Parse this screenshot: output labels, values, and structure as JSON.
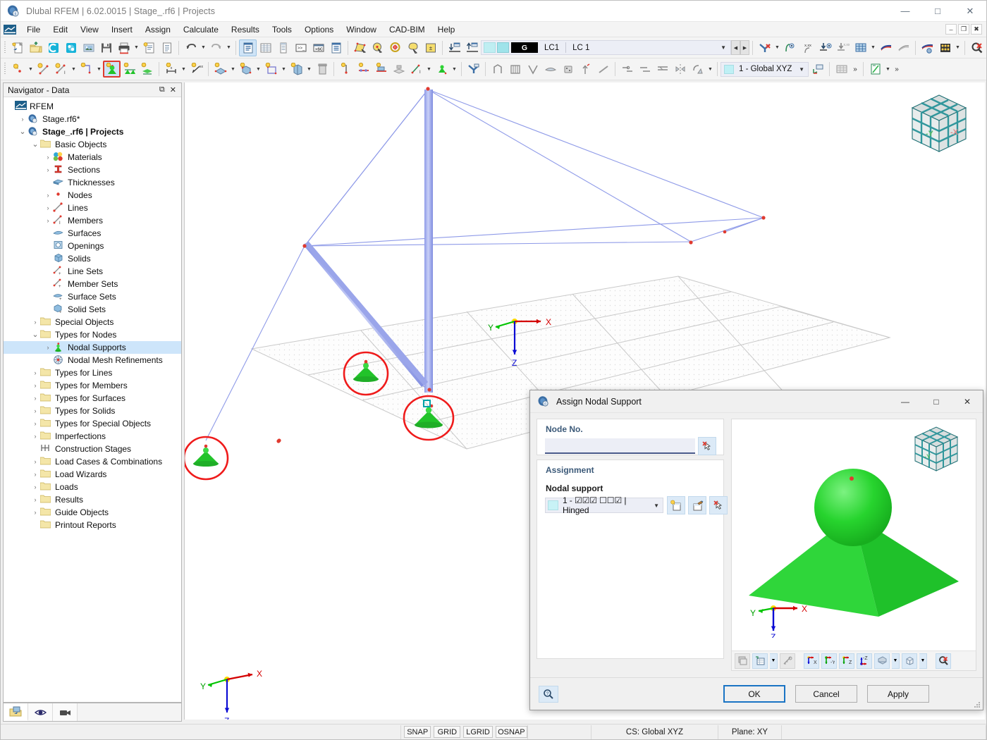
{
  "window": {
    "title": "Dlubal RFEM | 6.02.0015 | Stage_.rf6 | Projects",
    "minimize": "—",
    "maximize": "□",
    "close": "✕",
    "mdi_minimize": "–",
    "mdi_restore": "❐",
    "mdi_close": "✖"
  },
  "menu": {
    "items": [
      "File",
      "Edit",
      "View",
      "Insert",
      "Assign",
      "Calculate",
      "Results",
      "Tools",
      "Options",
      "Window",
      "CAD-BIM",
      "Help"
    ]
  },
  "toolbar_main": {
    "load_case": {
      "badge": "G",
      "code": "LC1",
      "name": "LC 1"
    },
    "icons": [
      "new-model-icon",
      "open-folder-icon",
      "cloud-connect-icon",
      "webservice-icon",
      "save-as-image-icon",
      "save-icon",
      "print-icon",
      "new-report-icon",
      "document-icon",
      "undo-icon",
      "redo-icon",
      "navigator-data-icon",
      "table-panel-icon",
      "table-single-icon",
      "console-icon",
      "script-icon",
      "report-icon",
      "select-area-icon",
      "select-objects-icon",
      "select-circle-icon",
      "select-lasso-icon",
      "select-by-value-icon",
      "lower-level-icon",
      "higher-level-icon",
      "visibility-icon",
      "render-icon",
      "result-value-icon",
      "support-display-icon",
      "grid-display-icon",
      "deformation-icon",
      "gradient-icon",
      "render-mode-icon",
      "abacus-icon",
      "zoom-reset-icon",
      "box-view-icon"
    ]
  },
  "toolbar_objects": {
    "cs_combo": {
      "value": "1 - Global XYZ"
    },
    "highlighted_tool": "nodal-support-tool",
    "icons": [
      "new-node-icon",
      "new-line-icon",
      "new-member-icon",
      "new-polyline-icon",
      "nodal-support-icon",
      "line-support-icon",
      "surface-support-icon",
      "dimension-icon",
      "dimension-xx-icon",
      "new-surface-icon",
      "new-solid-icon",
      "new-opening-icon",
      "new-plate-icon",
      "delete-icon",
      "node-release-icon",
      "line-hinge-icon",
      "member-hinge-icon",
      "member-eccentricity-icon",
      "line-set-icon",
      "member-set-icon",
      "filter-icon",
      "frame-wizard-icon",
      "truss-wizard-icon",
      "arch-wizard-icon",
      "surface-wizard-icon",
      "solid-wizard-icon",
      "extrude-icon",
      "line-tools-icon",
      "curve-tools-icon",
      "spline-icon",
      "offset-icon",
      "mirror-icon"
    ]
  },
  "navigator": {
    "title": "Navigator - Data",
    "header_buttons": [
      "undock-icon",
      "close-icon"
    ],
    "tree": [
      {
        "label": "RFEM",
        "depth": 0,
        "icon": "rfem-icon",
        "expander": "",
        "bold": false
      },
      {
        "label": "Stage.rf6*",
        "depth": 1,
        "icon": "model-icon",
        "expander": "›",
        "bold": false
      },
      {
        "label": "Stage_.rf6 | Projects",
        "depth": 1,
        "icon": "model-icon",
        "expander": "⌄",
        "bold": true
      },
      {
        "label": "Basic Objects",
        "depth": 2,
        "icon": "folder-icon",
        "expander": "⌄",
        "bold": false
      },
      {
        "label": "Materials",
        "depth": 3,
        "icon": "materials-icon",
        "expander": "›",
        "bold": false
      },
      {
        "label": "Sections",
        "depth": 3,
        "icon": "sections-icon",
        "expander": "›",
        "bold": false
      },
      {
        "label": "Thicknesses",
        "depth": 3,
        "icon": "thicknesses-icon",
        "expander": "",
        "bold": false
      },
      {
        "label": "Nodes",
        "depth": 3,
        "icon": "nodes-icon",
        "expander": "›",
        "bold": false
      },
      {
        "label": "Lines",
        "depth": 3,
        "icon": "lines-icon",
        "expander": "›",
        "bold": false
      },
      {
        "label": "Members",
        "depth": 3,
        "icon": "members-icon",
        "expander": "›",
        "bold": false
      },
      {
        "label": "Surfaces",
        "depth": 3,
        "icon": "surfaces-icon",
        "expander": "",
        "bold": false
      },
      {
        "label": "Openings",
        "depth": 3,
        "icon": "openings-icon",
        "expander": "",
        "bold": false
      },
      {
        "label": "Solids",
        "depth": 3,
        "icon": "solids-icon",
        "expander": "",
        "bold": false
      },
      {
        "label": "Line Sets",
        "depth": 3,
        "icon": "line-sets-icon",
        "expander": "",
        "bold": false
      },
      {
        "label": "Member Sets",
        "depth": 3,
        "icon": "member-sets-icon",
        "expander": "",
        "bold": false
      },
      {
        "label": "Surface Sets",
        "depth": 3,
        "icon": "surface-sets-icon",
        "expander": "",
        "bold": false
      },
      {
        "label": "Solid Sets",
        "depth": 3,
        "icon": "solid-sets-icon",
        "expander": "",
        "bold": false
      },
      {
        "label": "Special Objects",
        "depth": 2,
        "icon": "folder-icon",
        "expander": "›",
        "bold": false
      },
      {
        "label": "Types for Nodes",
        "depth": 2,
        "icon": "folder-icon",
        "expander": "⌄",
        "bold": false
      },
      {
        "label": "Nodal Supports",
        "depth": 3,
        "icon": "nodal-support-icon",
        "expander": "›",
        "bold": false,
        "selected": true
      },
      {
        "label": "Nodal Mesh Refinements",
        "depth": 3,
        "icon": "mesh-refinement-icon",
        "expander": "",
        "bold": false
      },
      {
        "label": "Types for Lines",
        "depth": 2,
        "icon": "folder-icon",
        "expander": "›",
        "bold": false
      },
      {
        "label": "Types for Members",
        "depth": 2,
        "icon": "folder-icon",
        "expander": "›",
        "bold": false
      },
      {
        "label": "Types for Surfaces",
        "depth": 2,
        "icon": "folder-icon",
        "expander": "›",
        "bold": false
      },
      {
        "label": "Types for Solids",
        "depth": 2,
        "icon": "folder-icon",
        "expander": "›",
        "bold": false
      },
      {
        "label": "Types for Special Objects",
        "depth": 2,
        "icon": "folder-icon",
        "expander": "›",
        "bold": false
      },
      {
        "label": "Imperfections",
        "depth": 2,
        "icon": "folder-icon",
        "expander": "›",
        "bold": false
      },
      {
        "label": "Construction Stages",
        "depth": 2,
        "icon": "construction-stages-icon",
        "expander": "",
        "bold": false
      },
      {
        "label": "Load Cases & Combinations",
        "depth": 2,
        "icon": "folder-icon",
        "expander": "›",
        "bold": false
      },
      {
        "label": "Load Wizards",
        "depth": 2,
        "icon": "folder-icon",
        "expander": "›",
        "bold": false
      },
      {
        "label": "Loads",
        "depth": 2,
        "icon": "folder-icon",
        "expander": "›",
        "bold": false
      },
      {
        "label": "Results",
        "depth": 2,
        "icon": "folder-icon",
        "expander": "›",
        "bold": false
      },
      {
        "label": "Guide Objects",
        "depth": 2,
        "icon": "folder-icon",
        "expander": "›",
        "bold": false
      },
      {
        "label": "Printout Reports",
        "depth": 2,
        "icon": "folder-icon",
        "expander": "",
        "bold": false
      }
    ],
    "bottom_tabs": [
      "project-navigator-tab",
      "display-navigator-tab",
      "views-navigator-tab"
    ]
  },
  "viewport": {
    "axes": {
      "x": "X",
      "y": "Y",
      "z": "Z"
    },
    "view_cube": {
      "left_face": "-Y",
      "right_face": "-X"
    },
    "highlight_count": 3
  },
  "dialog": {
    "title": "Assign Nodal Support",
    "minimize": "—",
    "maximize": "□",
    "close": "✕",
    "node_no": {
      "label": "Node No.",
      "value": "",
      "placeholder": "",
      "pick_button": "pick-node-icon"
    },
    "assignment": {
      "label": "Assignment",
      "field_label": "Nodal support",
      "selected": "1 - ☑☑☑ ☐☐☑ | Hinged",
      "buttons": [
        "new-support-icon",
        "edit-support-icon",
        "pick-support-icon"
      ]
    },
    "preview": {
      "axes": {
        "x": "X",
        "y": "Y",
        "z": "Z"
      },
      "view_cube": {
        "left_face": "-Y"
      },
      "toolbar": [
        "print-preview-icon",
        "display-properties-icon",
        "measure-icon",
        "view-x-icon",
        "view-y-icon",
        "view-z-icon",
        "view-neg-z-icon",
        "render-mode-icon",
        "box-view-icon",
        "zoom-reset-icon"
      ],
      "axis_buttons": [
        "X",
        "-Y",
        "Z",
        "-Z"
      ]
    },
    "footer": {
      "help": "help-icon",
      "ok": "OK",
      "cancel": "Cancel",
      "apply": "Apply"
    }
  },
  "statusbar": {
    "toggles": [
      "SNAP",
      "GRID",
      "LGRID",
      "OSNAP"
    ],
    "cs": "CS: Global XYZ",
    "plane": "Plane: XY"
  }
}
